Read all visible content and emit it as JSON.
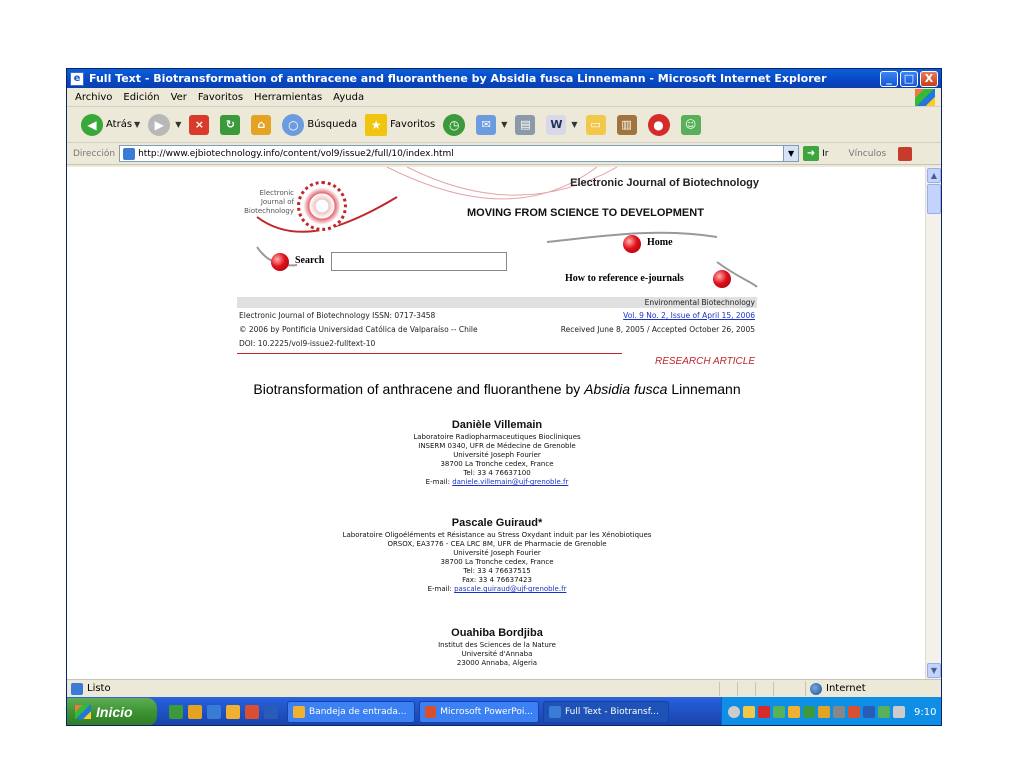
{
  "window": {
    "title": "Full Text - Biotransformation of anthracene and fluoranthene by Absidia fusca Linnemann - Microsoft Internet Explorer",
    "controls": [
      "_",
      "□",
      "X"
    ]
  },
  "menu": [
    "Archivo",
    "Edición",
    "Ver",
    "Favoritos",
    "Herramientas",
    "Ayuda"
  ],
  "toolbar": {
    "back": "Atrás",
    "search": "Búsqueda",
    "favorites": "Favoritos"
  },
  "address": {
    "label": "Dirección",
    "url": "http://www.ejbiotechnology.info/content/vol9/issue2/full/10/index.html",
    "go": "Ir",
    "links": "Vínculos"
  },
  "page": {
    "logo_text": "Electronic Journal of Biotechnology",
    "journal": "Electronic Journal of Biotechnology",
    "tagline": "MOVING FROM SCIENCE TO DEVELOPMENT",
    "home": "Home",
    "search_label": "Search",
    "howto": "How to reference e-journals",
    "section": "Environmental Biotechnology",
    "issn": "Electronic Journal of Biotechnology ISSN: 0717-3458",
    "volume": "Vol. 9 No. 2, Issue of April 15, 2006",
    "copyright": "© 2006 by Pontificia Universidad Católica de Valparaíso -- Chile",
    "received": "Received June 8, 2005 / Accepted October 26, 2005",
    "doi": "DOI: 10.2225/vol9-issue2-fulltext-10",
    "article_type": "RESEARCH ARTICLE",
    "title_pre": "Biotransformation of anthracene and fluoranthene by ",
    "title_italic": "Absidia fusca",
    "title_post": " Linnemann",
    "authors": [
      {
        "name": "Danièle Villemain",
        "lines": [
          "Laboratoire Radiopharmaceutiques Biocliniques",
          "INSERM 0340, UFR de Médecine de Grenoble",
          "Université Joseph Fourier",
          "38700 La Tronche cedex, France",
          "Tel: 33 4 76637100"
        ],
        "email_label": "E-mail: ",
        "email": "daniele.villemain@ujf-grenoble.fr"
      },
      {
        "name": "Pascale Guiraud*",
        "lines": [
          "Laboratoire Oligoéléments et Résistance au Stress Oxydant induit par les Xénobiotiques",
          "ORSOX, EA3776 - CEA LRC 8M, UFR de Pharmacie de Grenoble",
          "Université Joseph Fourier",
          "38700 La Tronche cedex, France",
          "Tel: 33 4 76637515",
          "Fax: 33 4 76637423"
        ],
        "email_label": "E-mail: ",
        "email": "pascale.guiraud@ujf-grenoble.fr"
      },
      {
        "name": "Ouahiba Bordjiba",
        "lines": [
          "Institut des Sciences de la Nature",
          "Université d'Annaba",
          "23000 Annaba, Algeria"
        ]
      }
    ]
  },
  "status": {
    "text": "Listo",
    "zone": "Internet"
  },
  "taskbar": {
    "start": "Inicio",
    "tasks": [
      "Bandeja de entrada...",
      "Microsoft PowerPoi...",
      "Full Text - Biotransf..."
    ],
    "clock": "9:10"
  }
}
